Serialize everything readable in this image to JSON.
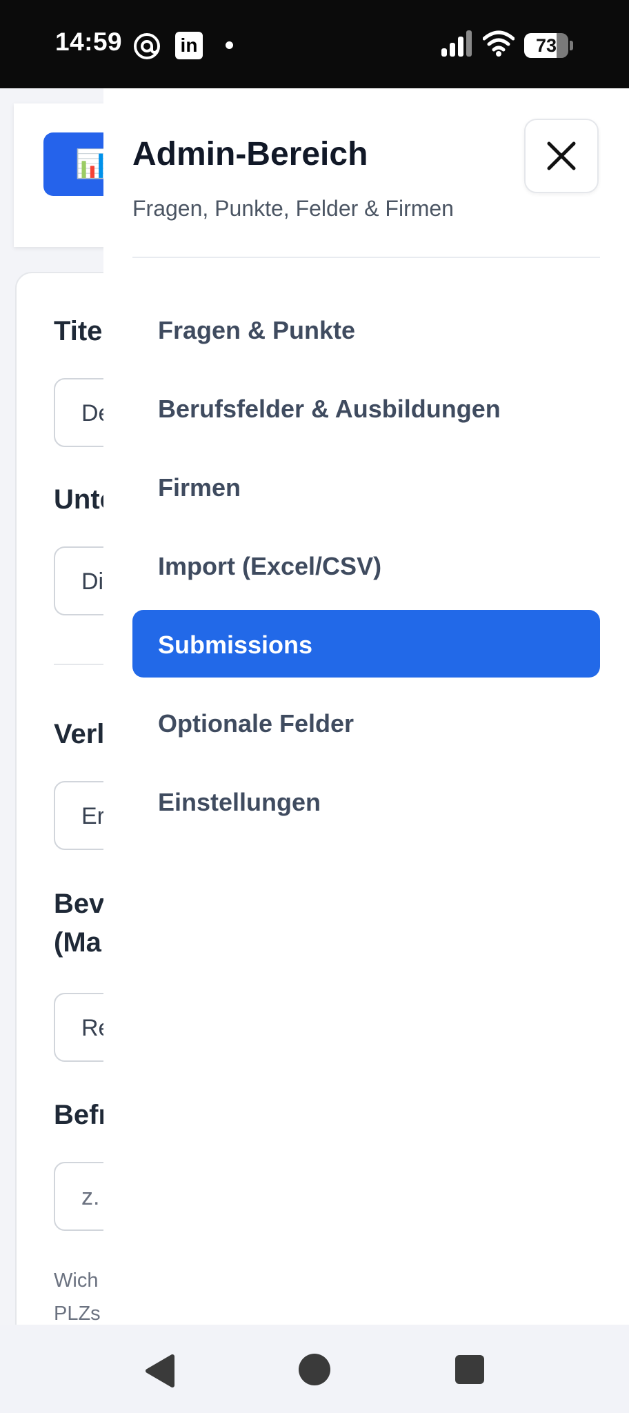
{
  "status_bar": {
    "time": "14:59",
    "linkedin_glyph": "in",
    "battery_percent": 73,
    "battery_label": "73",
    "icons": [
      "threads-icon",
      "linkedin-icon",
      "notification-dot",
      "signal-icon",
      "wifi-icon",
      "battery-icon"
    ]
  },
  "background_form": {
    "header_icon": "📊",
    "fields": [
      {
        "label": "Tite",
        "value": "De"
      },
      {
        "label": "Unte",
        "value": "Di"
      },
      {
        "label": "Verl",
        "value": "Er"
      },
      {
        "label": "Bev",
        "label_line2": "(Ma",
        "value": "Re"
      },
      {
        "label": "Befr",
        "value": "z."
      }
    ],
    "hint_line1": "Wich",
    "hint_line2": "PLZs"
  },
  "drawer": {
    "title": "Admin-Bereich",
    "subtitle": "Fragen, Punkte, Felder & Firmen",
    "close_icon": "close-icon",
    "items": [
      {
        "label": "Fragen & Punkte",
        "active": false
      },
      {
        "label": "Berufsfelder & Ausbildungen",
        "active": false
      },
      {
        "label": "Firmen",
        "active": false
      },
      {
        "label": "Import (Excel/CSV)",
        "active": false
      },
      {
        "label": "Submissions",
        "active": true
      },
      {
        "label": "Optionale Felder",
        "active": false
      },
      {
        "label": "Einstellungen",
        "active": false
      }
    ]
  },
  "colors": {
    "accent": "#2269e8",
    "nav_text": "#3f4b5f",
    "title_text": "#111827"
  },
  "nav_bar": {
    "icons": [
      "back-icon",
      "home-icon",
      "recents-icon"
    ]
  }
}
